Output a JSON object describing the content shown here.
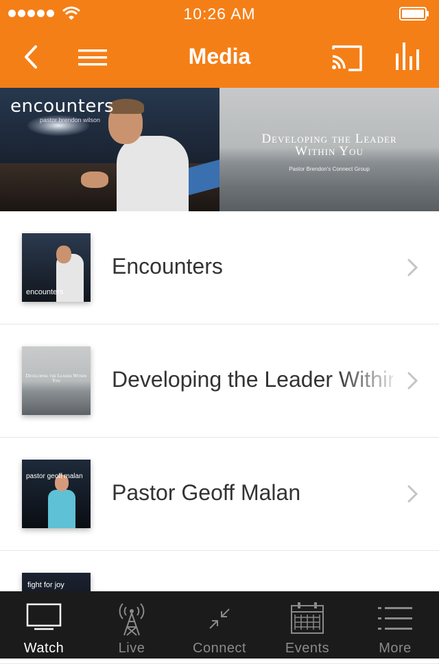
{
  "status_bar": {
    "time": "10:26 AM"
  },
  "header": {
    "title": "Media"
  },
  "banner": {
    "left": {
      "title": "encounters",
      "subtitle": "pastor brendon wilson"
    },
    "right": {
      "title_line1": "Developing the Leader",
      "title_line2": "Within You",
      "subtitle": "Pastor Brendon's Connect Group"
    }
  },
  "media_items": [
    {
      "label": "Encounters",
      "thumb_text": "encounters"
    },
    {
      "label": "Developing the Leader Within You",
      "thumb_text": "Developing the Leader Within You"
    },
    {
      "label": "Pastor Geoff Malan",
      "thumb_text": "pastor geoff malan"
    },
    {
      "label": "",
      "thumb_text": "fight for joy"
    }
  ],
  "tabs": [
    {
      "label": "Watch",
      "icon": "tv-icon",
      "active": true
    },
    {
      "label": "Live",
      "icon": "broadcast-tower-icon",
      "active": false
    },
    {
      "label": "Connect",
      "icon": "connect-arrows-icon",
      "active": false
    },
    {
      "label": "Events",
      "icon": "calendar-icon",
      "active": false
    },
    {
      "label": "More",
      "icon": "list-icon",
      "active": false
    }
  ],
  "colors": {
    "accent": "#f57f17",
    "tab_bar": "#1b1b1b",
    "tab_active": "#ffffff",
    "tab_inactive": "#8a8a8a"
  }
}
